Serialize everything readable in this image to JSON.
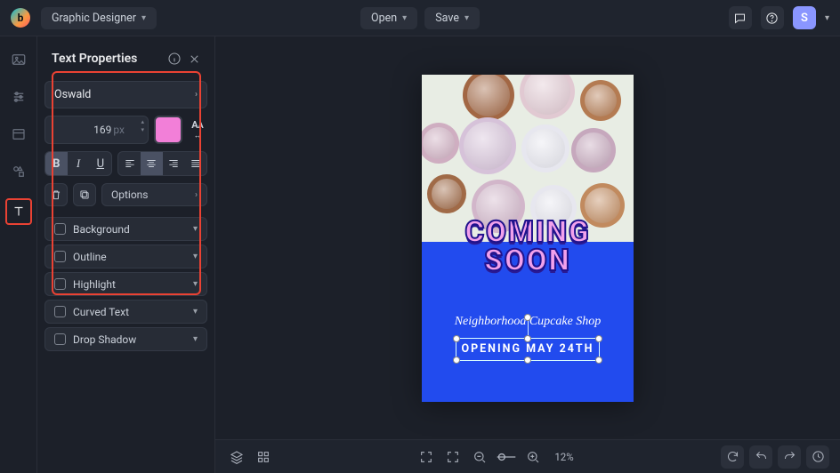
{
  "header": {
    "app_label": "Graphic Designer",
    "open_label": "Open",
    "save_label": "Save",
    "avatar_letter": "S"
  },
  "panel": {
    "title": "Text Properties",
    "font_family": "Oswald",
    "font_size_value": "169",
    "font_size_unit": "px",
    "color_hex": "#f27fd8",
    "bold_active": true,
    "align_active": "center",
    "options_label": "Options",
    "effects": [
      {
        "label": "Background",
        "checked": false
      },
      {
        "label": "Outline",
        "checked": false
      },
      {
        "label": "Highlight",
        "checked": false
      },
      {
        "label": "Curved Text",
        "checked": false
      },
      {
        "label": "Drop Shadow",
        "checked": false
      }
    ]
  },
  "canvas": {
    "headline_line1": "COMING",
    "headline_line2": "SOON",
    "subtitle": "Neighborhood Cupcake Shop",
    "selected_text": "OPENING MAY 24TH"
  },
  "bottom": {
    "zoom_label": "12%"
  }
}
